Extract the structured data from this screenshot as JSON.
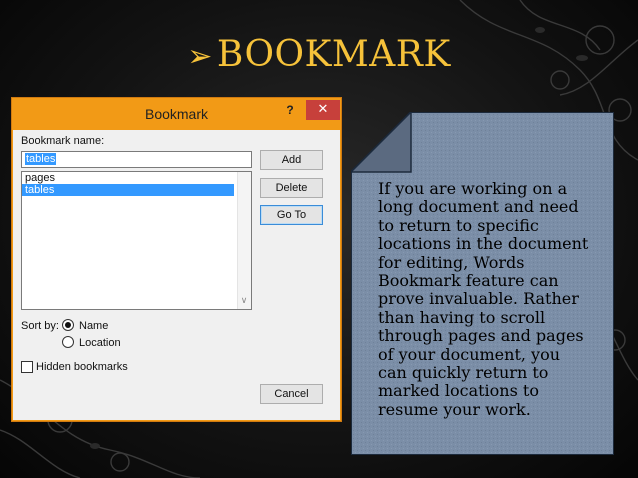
{
  "slide": {
    "title_arrow": "➢",
    "title": "BOOKMARK",
    "title_color": "#f6c23a",
    "body_text": "If you are working on a\nlong document and need\nto return to specific\nlocations in the document\nfor editing,  Words\nBookmark feature can\nprove invaluable. Rather\nthan having to scroll\nthrough pages and pages\nof your document, you\ncan quickly return to\nmarked locations to\nresume your work.",
    "panel_color": "#7b8ea7"
  },
  "dialog": {
    "title": "Bookmark",
    "help_label": "?",
    "close_label": "✕",
    "titlebar_color": "#f29a16",
    "bookmark_name_label": "Bookmark name:",
    "bookmark_name_value": "tables",
    "list_items": [
      "pages",
      "tables"
    ],
    "selected_item": "tables",
    "buttons": {
      "add": "Add",
      "delete": "Delete",
      "goto": "Go To",
      "cancel": "Cancel"
    },
    "sort_by_label": "Sort by:",
    "sort_options": [
      "Name",
      "Location"
    ],
    "sort_selected": "Name",
    "hidden_bookmarks_label": "Hidden bookmarks",
    "hidden_bookmarks_checked": false
  }
}
